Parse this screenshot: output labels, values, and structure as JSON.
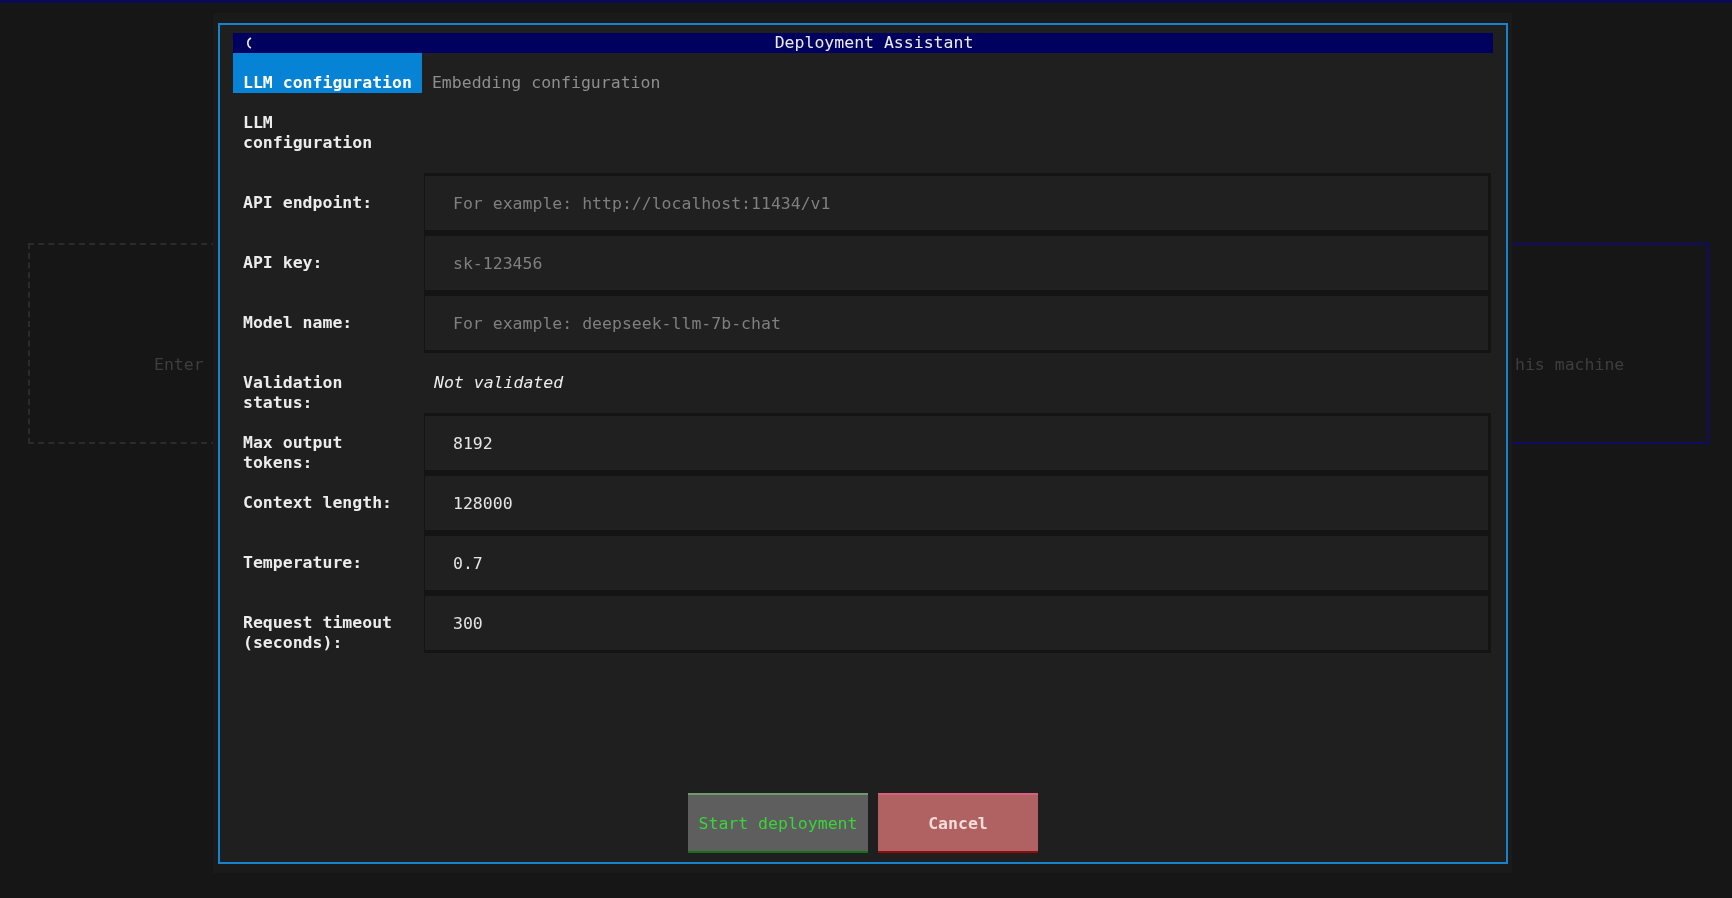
{
  "background": {
    "left_panel": {
      "text": "Enter"
    },
    "right_panel": {
      "text": "his machine"
    }
  },
  "dialog": {
    "title": "Deployment Assistant",
    "tabs": [
      {
        "label": "LLM configuration",
        "selected": true
      },
      {
        "label": "Embedding configuration",
        "selected": false
      }
    ],
    "section_title": "LLM configuration",
    "fields": [
      {
        "kind": "input",
        "label": "API endpoint:",
        "placeholder": "For example: http://localhost:11434/v1"
      },
      {
        "kind": "input",
        "label": "API key:",
        "placeholder": "sk-123456"
      },
      {
        "kind": "input",
        "label": "Model name:",
        "placeholder": "For example: deepseek-llm-7b-chat"
      },
      {
        "kind": "status",
        "label": "Validation status:",
        "value": "Not validated"
      },
      {
        "kind": "input",
        "label": "Max output tokens:",
        "value": "8192"
      },
      {
        "kind": "input",
        "label": "Context length:",
        "value": "128000"
      },
      {
        "kind": "input",
        "label": "Temperature:",
        "value": "0.7"
      },
      {
        "kind": "input",
        "label": "Request timeout (seconds):",
        "value": "300"
      }
    ],
    "buttons": [
      {
        "kind": "primary",
        "label": "Start deployment"
      },
      {
        "kind": "cancel",
        "label": "Cancel"
      }
    ]
  }
}
